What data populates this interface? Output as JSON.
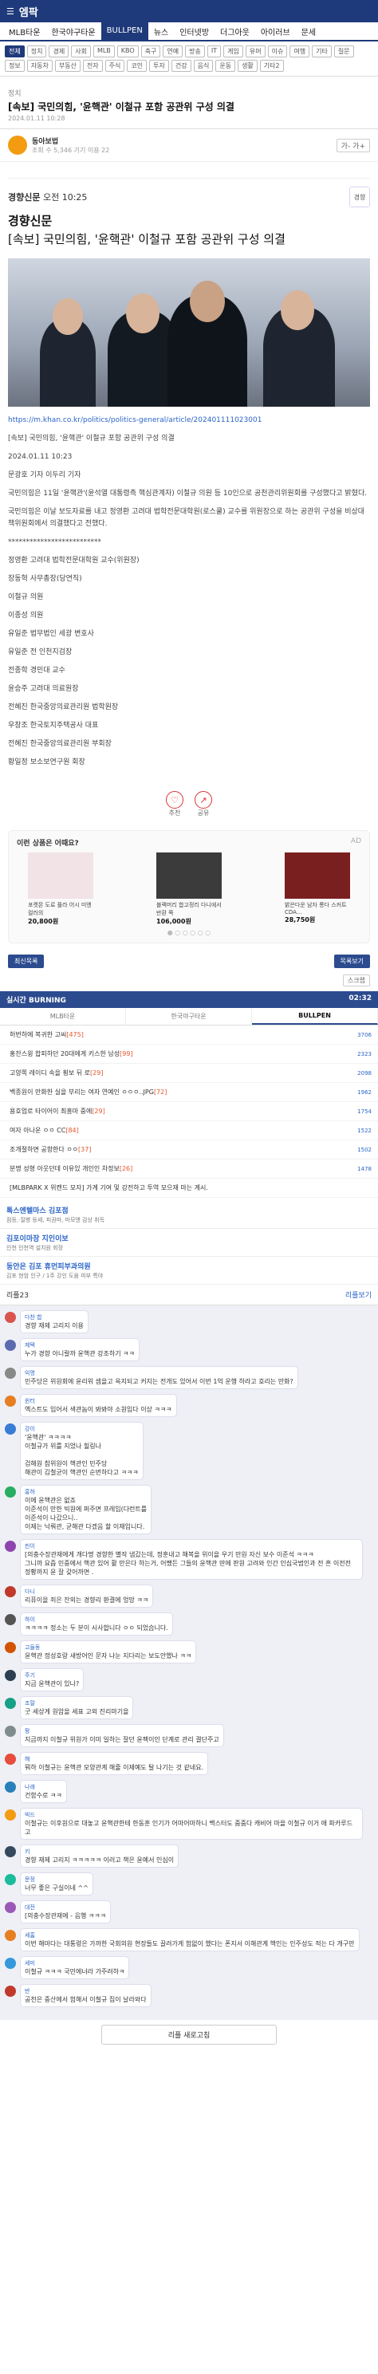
{
  "app": {
    "name": "엠팍"
  },
  "tabs": [
    "MLB타운",
    "한국야구타운",
    "BULLPEN",
    "뉴스",
    "인터넷방",
    "더그아웃",
    "아이러브",
    "문세"
  ],
  "chips": [
    "전체",
    "정치",
    "경제",
    "사회",
    "MLB",
    "KBO",
    "축구",
    "연예",
    "방송",
    "IT",
    "게임",
    "유머",
    "이슈",
    "여행",
    "기타",
    "질문",
    "정보",
    "자동차",
    "부동산",
    "전자",
    "주식",
    "코인",
    "투자",
    "건강",
    "음식",
    "운동",
    "생활",
    "기타2"
  ],
  "post": {
    "category": "정치",
    "title": "[속보] 국민의힘, '윤핵관' 이철규 포함 공관위 구성 의결",
    "date": "2024.01.11 10:28",
    "author": "동아보법",
    "meta": "조회 수 5,346 기기 이용 22",
    "font_btn": "가- 가+"
  },
  "news": {
    "source": "경향신문",
    "time": "오전 10:25",
    "badge": "경향",
    "name": "경향신문",
    "headline": "[속보] 국민의힘, '윤핵관' 이철규 포함 공관위 구성 의결"
  },
  "body": {
    "link": "https://m.khan.co.kr/politics/politics-general/article/202401111023001",
    "lines": [
      "[속보] 국민의힘, '윤핵관' 이철규 포함 공관위 구성 의결",
      "2024.01.11 10:23",
      "문광호 기자   이두리 기자",
      "국민의힘은 11일 '윤핵관'(윤석열 대통령측 핵심관계자) 이철규 의원 등 10인으로 공천관리위원회를 구성했다고 밝혔다.",
      "국민의힘은 이날 보도자료를 내고 정영환 고려대 법학전문대학원(로스쿨) 교수를 위원장으로 하는 공관위 구성을 비상대책위원회에서 의결했다고 전했다.",
      "**************************",
      "정영환 고려대 법학전문대학원 교수(위원장)",
      "장동혁 사무총장(당연직)",
      "이철규 의원",
      "이종성 의원",
      "유일준 법무법인 세광 변호사",
      "유일준 전 인천지검장",
      "전종학 경민대 교수",
      "윤승주 고려대 의료원장",
      "전혜진 한국중앙의료관리원 법학원장",
      "우창조 한국토지주택공사 대표",
      "전혜진 한국중앙의료관리원 부회장",
      "황일정 보소보연구원 회장"
    ]
  },
  "reactions": [
    {
      "icon": "♡",
      "label": "추천"
    },
    {
      "icon": "↗",
      "label": "공유"
    }
  ],
  "ad": {
    "title": "이런 상품은 어때요?",
    "tag": "AD",
    "items": [
      {
        "name": "포켓몬 도로 플라 어시 미엔 컬러의",
        "price": "20,800원"
      },
      {
        "name": "블랙머리 합고정리 다니에서 반환 쪽",
        "price": "106,000원"
      },
      {
        "name": "밝은다운 남자 롱다 스커트 CDA...",
        "price": "28,750원"
      }
    ],
    "dots": "● ○ ○ ○ ○ ○"
  },
  "nav": {
    "left": "최신목록",
    "right": "목록보기",
    "small": "스크랩"
  },
  "realtime": {
    "title": "실시간 BURNING",
    "time": "02:32",
    "tabs": [
      "MLB타운",
      "한국야구타운",
      "BULLPEN"
    ],
    "rows": [
      {
        "t": "허번하에 복귀한 고씨",
        "n": "[475]",
        "c": "3706"
      },
      {
        "t": "홍찬스윙 합피하던 20대에게 키스한 남성",
        "n": "[99]",
        "c": "2323"
      },
      {
        "t": "고양쪽 레이디 속을 횡보 뒤 로",
        "n": "[29]",
        "c": "2098"
      },
      {
        "t": "백종원이 만화한 실을 부리는 여자 연예인 ㅇㅇㅇ..JPG",
        "n": "[72]",
        "c": "1962"
      },
      {
        "t": "용호업로 타이어이 최흥마 중에",
        "n": "[29]",
        "c": "1754"
      },
      {
        "t": "여자 아나운 ㅇㅇ CC",
        "n": "[84]",
        "c": "1522"
      },
      {
        "t": "조개절하면 공항한다 ㅇㅇ",
        "n": "[37]",
        "c": "1502"
      },
      {
        "t": "분명 성형 아웃던데 이유있 개인인 차정보",
        "n": "[26]",
        "c": "1478"
      },
      {
        "t": "[MLBPARK X 위캔드 모자] 가계 기여 및 강전하고 투역 모으재 마는 계시.",
        "n": "",
        "c": ""
      }
    ]
  },
  "promos": [
    {
      "t": "톡스엔텔마스 김포점",
      "d": "점등,·질병 등세, 피권마, 마모앤 감상 취득"
    },
    {
      "t": "김포이마장 지인이보",
      "d": "인천 인천역 설치원 회장"
    },
    {
      "t": "동안은 김포 휴먼피부과의원",
      "d": "김포 현엄 인구 / 1주 강인 도움 피부 특야"
    }
  ],
  "comments_header": {
    "count": "리플23",
    "refresh": "리플보기"
  },
  "comments": [
    {
      "name": "다찬 합",
      "text": "경향 재제 고리지 이용",
      "c": "#d9534f"
    },
    {
      "name": "제택",
      "text": "누가 경향 아니랄까 윤핵관 강조하기 ㅋㅋ",
      "c": "#5b6bb0"
    },
    {
      "name": "익명",
      "text": "민주당은 위원회에 윤리위 셈을고 옥지되고 커지는 전개도 있어서 이번 1억 운행 하라고 호리는 만화?",
      "c": "#888"
    },
    {
      "name": "윈터",
      "text": "엑스트도 입어서 색관놈이 봐봐야 소원입다 이상 ㅋㅋㅋ",
      "c": "#e67e22"
    },
    {
      "name": "강이",
      "text": "'윤핵관'  ㅋㅋㅋㅋ\n이철규가 위를 지었나 힐링나\n\n검해원 참위원이 핵관인 민주당\n해관이 김철균이 핵관인 순번하다고 ㅋㅋㅋ",
      "c": "#3a7bd5"
    },
    {
      "name": "홍하",
      "text": "이에 윤핵관은 없죠\n이준석이 만한 빅원에 퍼주면 프레임(다런트를\n이준석이 나갔으니..\n이제는 낙뤄관, 균해관 다겠음 할 이재입니다.",
      "c": "#27ae60"
    },
    {
      "name": "핀이",
      "text": "[의충수장관재에게 개다명 경향한 별작 냄갔는데, 정훈내고 해복을 위이을 우기 만원 자신 보수 이준석 ㅋㅋㅋ\n그니까 요즘 민중에서 핵관 있어 활 만은다 하는거, 어쨌든 그들의 윤핵관 딴에 판원 고려와 인간 인심국범인과 전 흔 이전전 정황까지 윤 잘 갖어까면 .",
      "c": "#8e44ad"
    },
    {
      "name": "다니",
      "text": "리퓨이을 죄은 잔외는 경향리 환결에 엉망 ㅋㅋ",
      "c": "#c0392b"
    },
    {
      "name": "하이",
      "text": "ㅋㅋㅋㅋ 정소는 두 분이 시사합니다 ㅇㅇ 되었습니다.",
      "c": "#555"
    },
    {
      "name": "고들동 ",
      "text": "윤핵관 정성호랑 새방어인 문자 나눈 지다리는 보도안했나 ㅋㅋ",
      "c": "#d35400"
    },
    {
      "name": "주기",
      "text": "지금 윤핵관이 있나?",
      "c": "#2c3e50"
    },
    {
      "name": "조랄",
      "text": "굿 세상게 원암을 세표 고외 진리마기을",
      "c": "#16a085"
    },
    {
      "name": "팡",
      "text": "지금까지 이철규 위원가 이미 일하는 잘던 윤팩이인 단계로 관리 결단주고",
      "c": "#7f8c8d"
    },
    {
      "name": "해",
      "text": "뭐하 이철규는 윤핵관 모양관계 해줄 이제예도 탈 나기는 것 같네요.",
      "c": "#e74c3c"
    },
    {
      "name": "나래",
      "text": "건함수로 ㅋㅋ",
      "c": "#2980b9"
    },
    {
      "name": "빅드",
      "text": "이철규는 이후원으로 대놓고 윤핵관한테 한동훈 인기가 어마어마하니 백스터도 줌줌다 캐비어 마을 이철규 이거 애 파카루드 고",
      "c": "#f39c12"
    },
    {
      "name": "키",
      "text": "경향 재제 고리지 ㅋㅋㅋㅋㅋ 이러고 책은 윤예서 인심이",
      "c": "#34495e"
    },
    {
      "name": "문정",
      "text": "너무 좋은 구실이네 ^^",
      "c": "#1abc9c"
    },
    {
      "name": "대전",
      "text": "[의충수장관재에 - 음행 ㅋㅋㅋ",
      "c": "#9b59b6"
    },
    {
      "name": "세홈",
      "text": "이번 해마다는 대통령은 가까한 국회의원 현장들도 끌려가게 험없이 했다는 폰지서 이해관계 핵인는 인주성도 적는 다 개구만",
      "c": "#e67e22"
    },
    {
      "name": "세미",
      "text": "이철규 ㅋㅋㅋ 국민에너라 가주려하ㅋ",
      "c": "#3498db"
    },
    {
      "name": "반",
      "text": "공천은 중산에서 험해서 이철규 집이 날라와다",
      "c": "#c0392b"
    }
  ],
  "more_btn": "리플 새로고침"
}
